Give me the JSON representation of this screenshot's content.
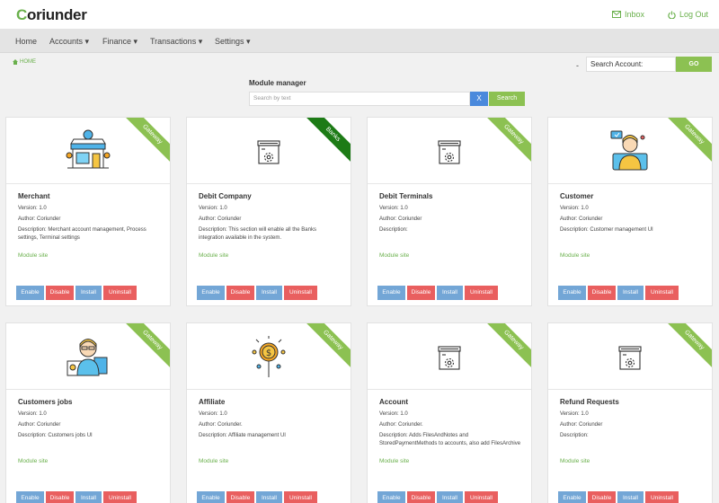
{
  "brand": {
    "logo_text_pre": "C",
    "logo_text_rest": "oriunder"
  },
  "top_links": {
    "inbox": "Inbox",
    "logout": "Log Out"
  },
  "nav": [
    "Home",
    "Accounts ▾",
    "Finance ▾",
    "Transactions ▾",
    "Settings ▾"
  ],
  "breadcrumb": "HOME",
  "search_account": {
    "placeholder": "Search Account:",
    "go": "GO",
    "dash": "-"
  },
  "module_manager": {
    "title": "Module manager",
    "search_placeholder": "Search by text",
    "clear": "X",
    "search": "Search"
  },
  "buttons": {
    "enable": "Enable",
    "disable": "Disable",
    "install": "Install",
    "uninstall": "Uninstall"
  },
  "module_site_label": "Module site",
  "modules": [
    {
      "name": "Merchant",
      "version": "Version: 1.0",
      "author": "Author: Coriunder",
      "description": "Description: Merchant account management, Process settings, Terminal settings",
      "ribbon": "Gateway",
      "icon": "store-icon"
    },
    {
      "name": "Debit Company",
      "version": "Version: 1.0",
      "author": "Author: Coriunder",
      "description": "Description: This section will enable all the Banks integration available in the system.",
      "ribbon": "Banks",
      "icon": "module-icon"
    },
    {
      "name": "Debit Terminals",
      "version": "Version: 1.0",
      "author": "Author: Coriunder",
      "description": "Description:",
      "ribbon": "Gateway",
      "icon": "module-icon"
    },
    {
      "name": "Customer",
      "version": "Version: 1.0",
      "author": "Author: Coriunder",
      "description": "Description: Customer management UI",
      "ribbon": "Gateway",
      "icon": "customer-icon"
    },
    {
      "name": "Customers jobs",
      "version": "Version: 1.0",
      "author": "Author: Coriunder",
      "description": "Description: Customers jobs UI",
      "ribbon": "Gateway",
      "icon": "customer-jobs-icon"
    },
    {
      "name": "Affiliate",
      "version": "Version: 1.0",
      "author": "Author: Coriunder.",
      "description": "Description: Affiliate management UI",
      "ribbon": "Gateway",
      "icon": "affiliate-icon"
    },
    {
      "name": "Account",
      "version": "Version: 1.0",
      "author": "Author: Coriunder.",
      "description": "Description: Adds FilesAndNotes and StoredPaymentMethods to accounts, also add FilesArchive",
      "ribbon": "Gateway",
      "icon": "module-icon"
    },
    {
      "name": "Refund Requests",
      "version": "Version: 1.0",
      "author": "Author: Coriunder",
      "description": "Description:",
      "ribbon": "Gateway",
      "icon": "module-icon"
    }
  ],
  "colors": {
    "accent_green": "#8cc152",
    "link_green": "#6ab04c",
    "banks_ribbon": "#1d7b16",
    "blue_btn": "#73a6d6",
    "red_btn": "#e95f5f",
    "search_blue": "#4a89dc"
  }
}
